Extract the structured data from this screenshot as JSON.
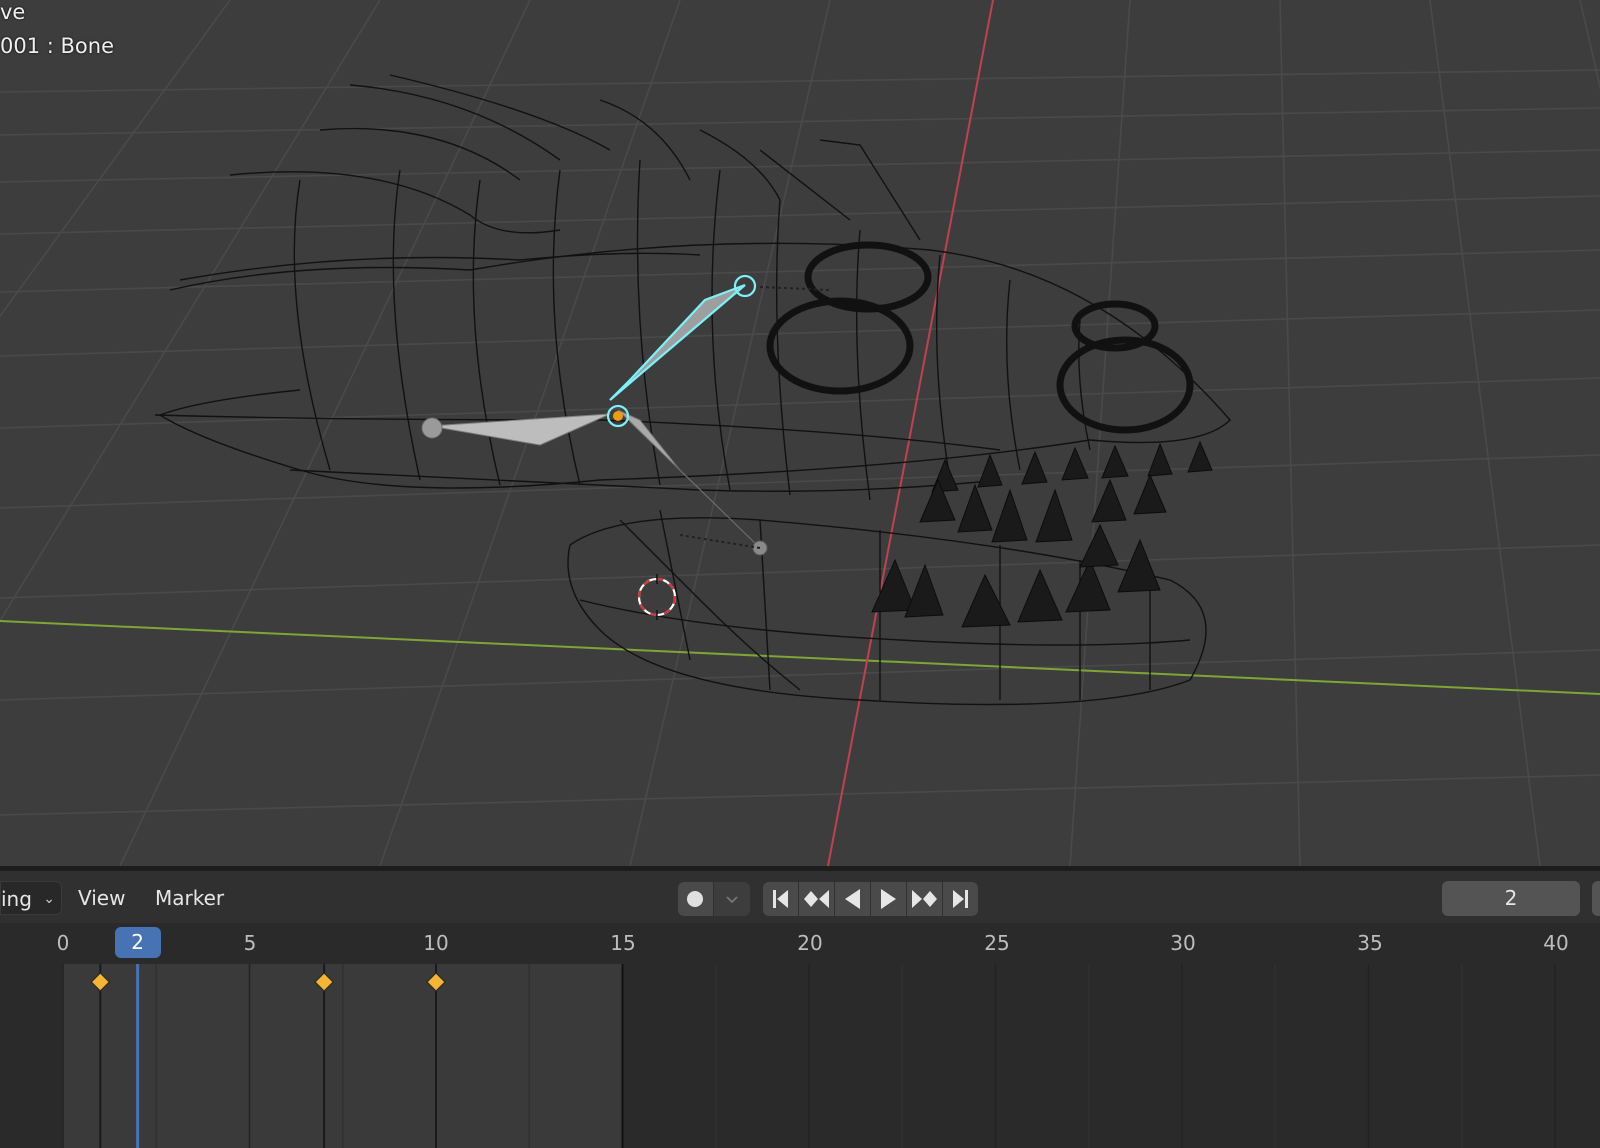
{
  "viewport": {
    "mode_text": "ve",
    "object_text": "001 : Bone"
  },
  "timeline": {
    "mode_dropdown": "ing",
    "menu_view": "View",
    "menu_marker": "Marker",
    "current_frame_field": "2",
    "current_frame": 2,
    "ruler_ticks": [
      "0",
      "5",
      "10",
      "15",
      "20",
      "25",
      "30",
      "35",
      "40"
    ],
    "keyframes": [
      1,
      7,
      10
    ],
    "preview_range_end": 15
  },
  "colors": {
    "accent": "#4772b3",
    "keyframe": "#f6b530",
    "selected_bone": "#7ef0f8",
    "x_axis": "#c2404f",
    "y_axis": "#7ea536"
  },
  "icons": [
    "record-icon",
    "jump-start-icon",
    "prev-keyframe-icon",
    "play-reverse-icon",
    "play-icon",
    "next-keyframe-icon",
    "jump-end-icon"
  ]
}
